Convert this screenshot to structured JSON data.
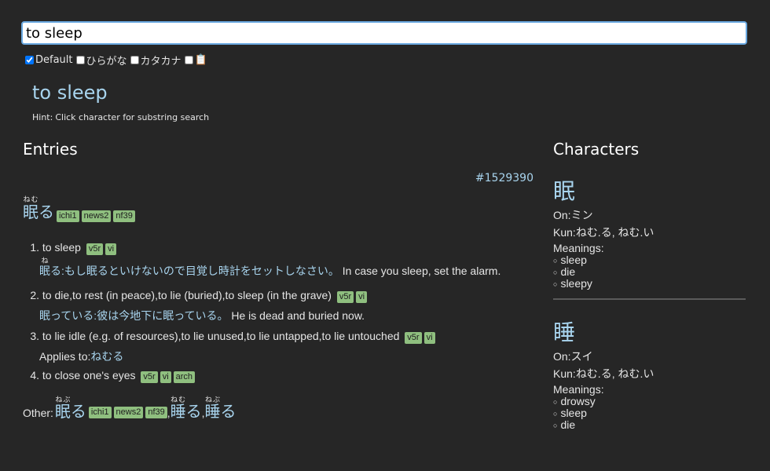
{
  "search": {
    "value": "to sleep"
  },
  "filters": {
    "default_label": "Default",
    "default_checked": true,
    "hiragana_label": "ひらがな",
    "katakana_label": "カタカナ",
    "clipboard_icon": "clipboard-icon"
  },
  "query_title": "to sleep",
  "hint": {
    "label": "Hint:",
    "text": "Click character for substring search"
  },
  "entries_heading": "Entries",
  "characters_heading": "Characters",
  "entry": {
    "id": "#1529390",
    "headword": {
      "kanji": "眠",
      "kana": "る",
      "reading": "ねむ"
    },
    "tags": [
      "ichi1",
      "news2",
      "nf39"
    ],
    "senses": [
      {
        "num": "1.",
        "gloss": "to sleep",
        "tags": [
          "v5r",
          "vi"
        ],
        "example": {
          "ruby_base": "眠",
          "ruby_text": "ね",
          "jp_rest": "る:もし眠るといけないので目覚し時計をセットしなさい。",
          "en": " In case you sleep, set the alarm."
        }
      },
      {
        "num": "2.",
        "gloss": "to die,to rest (in peace),to lie (buried),to sleep (in the grave)",
        "tags": [
          "v5r",
          "vi"
        ],
        "example": {
          "jp": "眠っている:彼は今地下に眠っている。",
          "en": " He is dead and buried now."
        }
      },
      {
        "num": "3.",
        "gloss": "to lie idle (e.g. of resources),to lie unused,to lie untapped,to lie untouched",
        "tags": [
          "v5r",
          "vi"
        ],
        "applies_label": "Applies to:",
        "applies_value": "ねむる"
      },
      {
        "num": "4.",
        "gloss": "to close one's eyes",
        "tags": [
          "v5r",
          "vi",
          "arch"
        ]
      }
    ],
    "other": {
      "label": "Other:",
      "forms": [
        {
          "kanji": "眠",
          "kana": "る",
          "reading": "ねぶ",
          "tags": [
            "ichi1",
            "news2",
            "nf39"
          ]
        },
        {
          "kanji": "睡",
          "kana": "る",
          "reading": "ねむ",
          "tags": []
        },
        {
          "kanji": "睡",
          "kana": "る",
          "reading": "ねぶ",
          "tags": []
        }
      ],
      "separator": ","
    }
  },
  "characters": [
    {
      "char": "眠",
      "on_label": "On:",
      "on": "ミン",
      "kun_label": "Kun:",
      "kun": "ねむ.る, ねむ.い",
      "meanings_label": "Meanings:",
      "meanings": [
        "sleep",
        "die",
        "sleepy"
      ]
    },
    {
      "char": "睡",
      "on_label": "On:",
      "on": "スイ",
      "kun_label": "Kun:",
      "kun": "ねむ.る, ねむ.い",
      "meanings_label": "Meanings:",
      "meanings": [
        "drowsy",
        "sleep",
        "die"
      ]
    }
  ]
}
